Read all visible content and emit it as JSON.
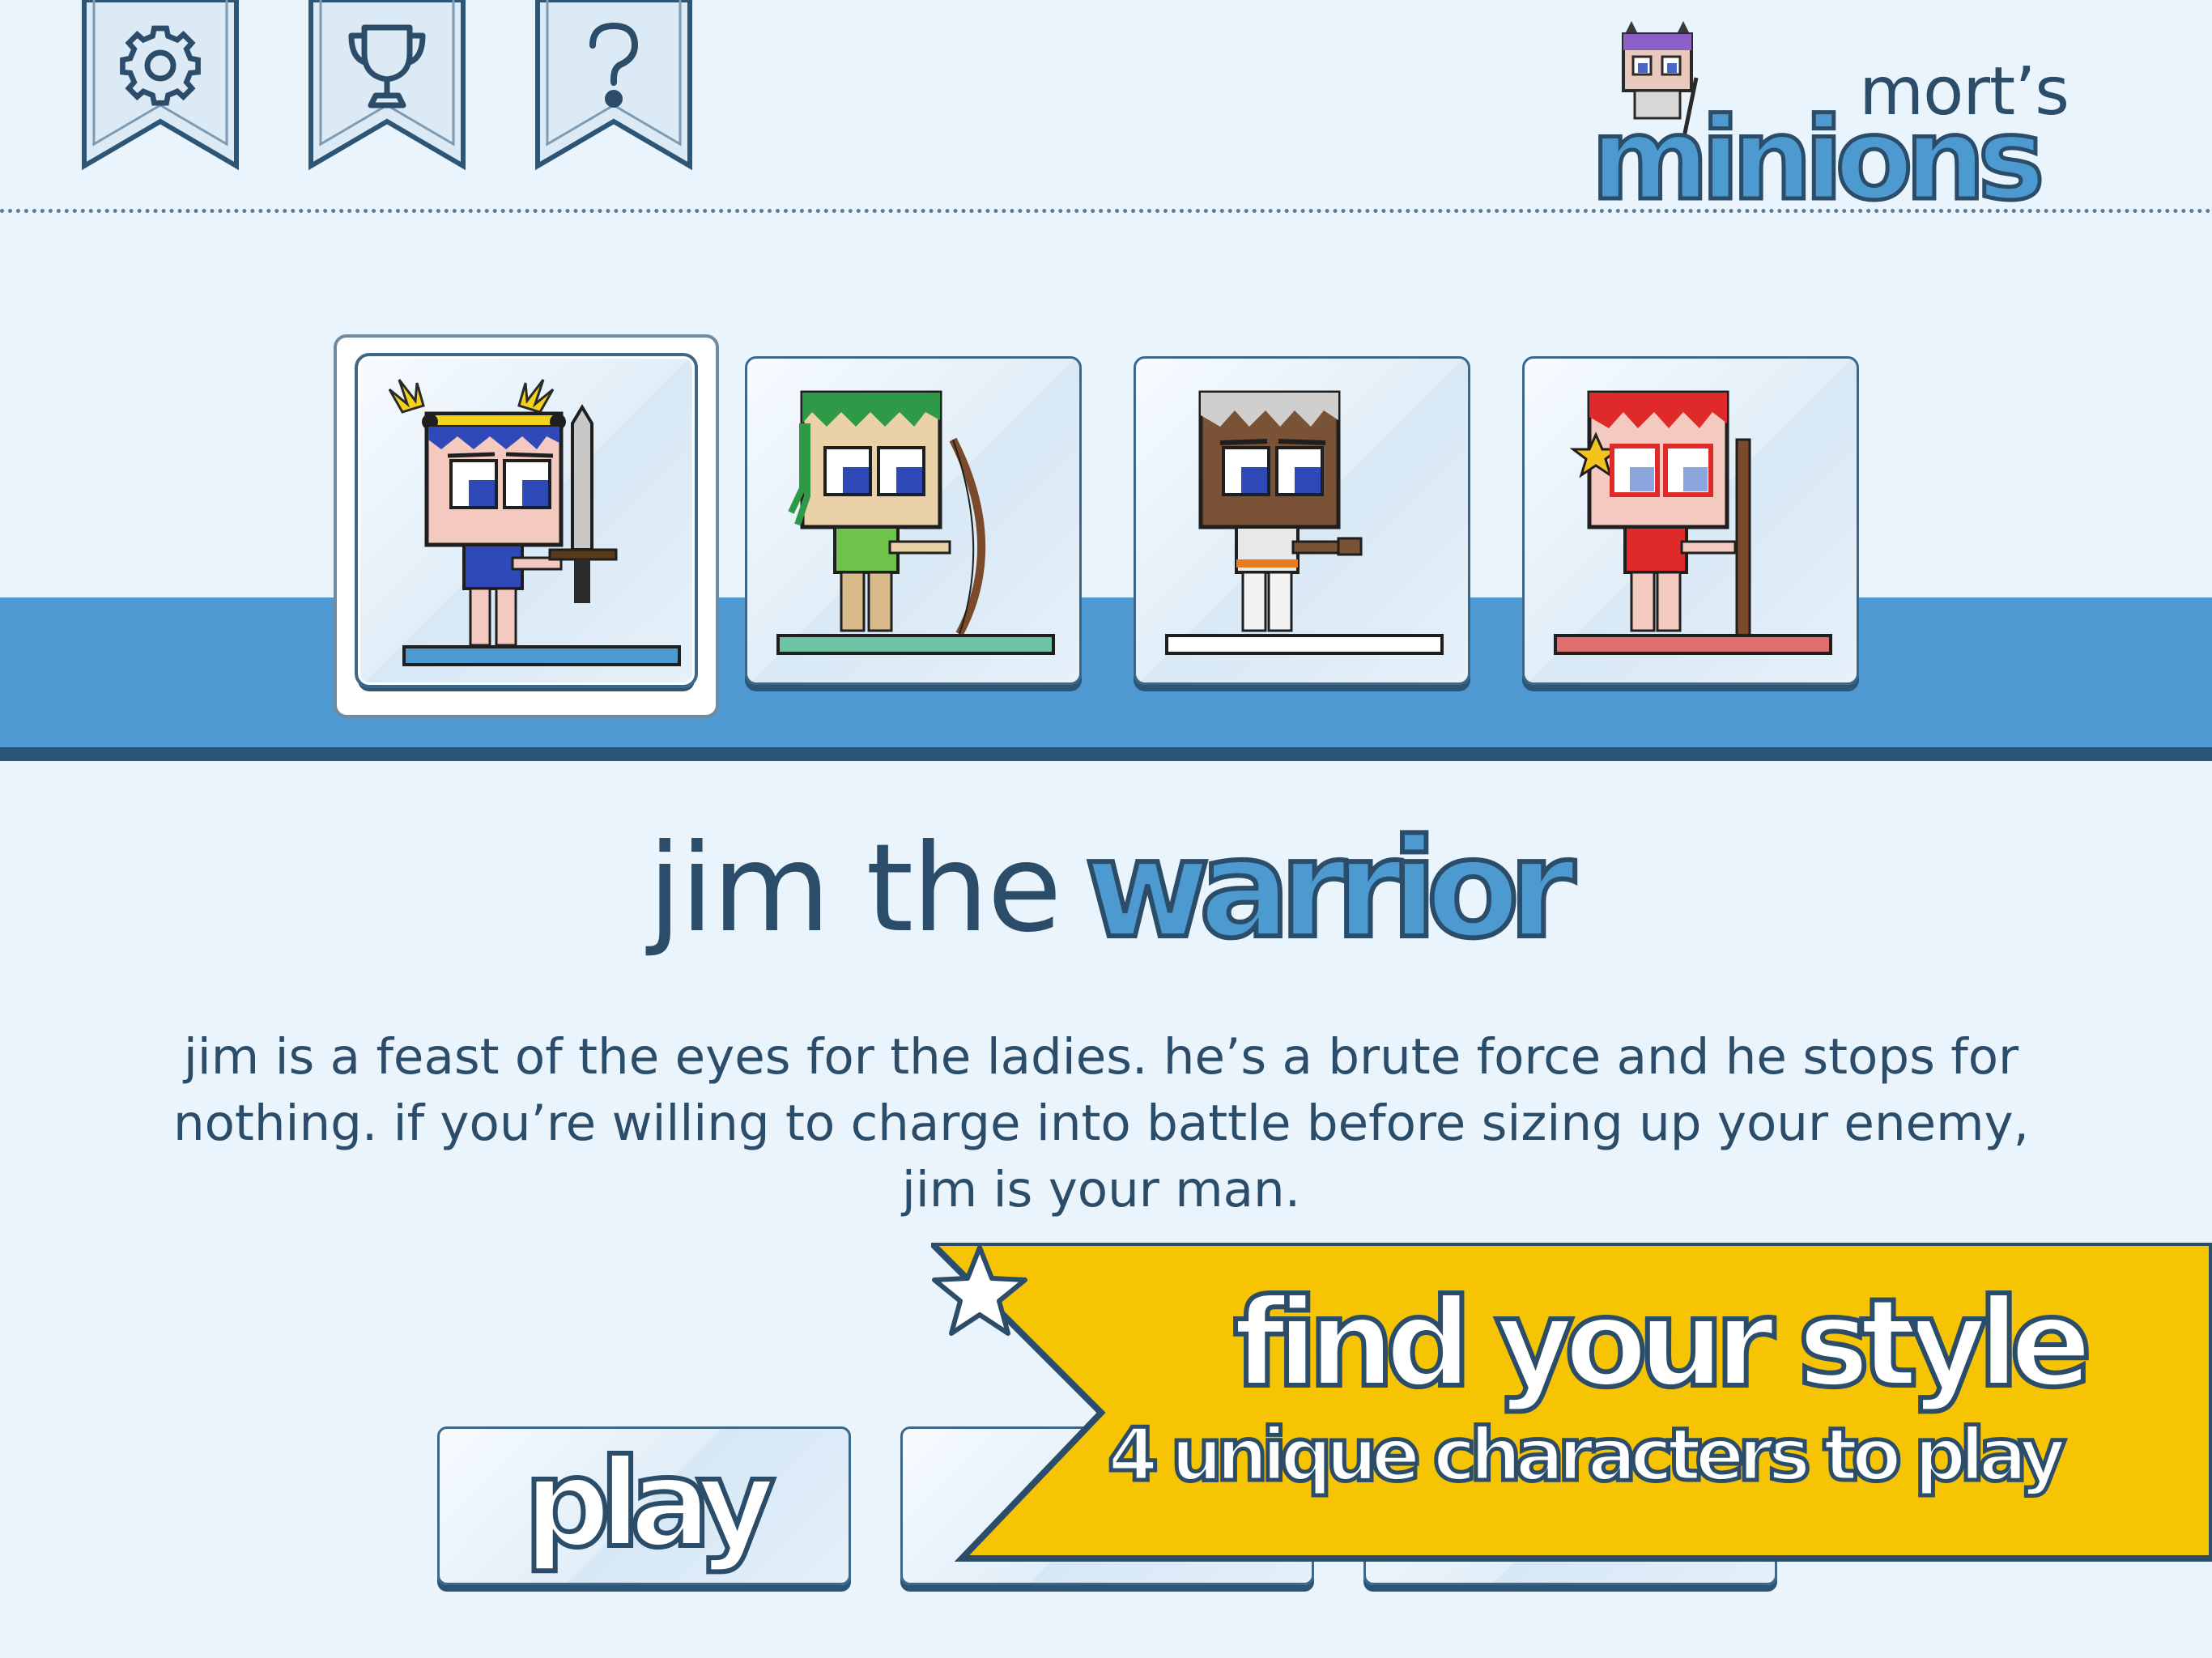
{
  "header": {
    "settings_icon": "gear-icon",
    "trophy_icon": "trophy-icon",
    "help_icon": "question-mark-icon"
  },
  "logo": {
    "top_text": "mort’s",
    "main_text": "minions"
  },
  "characters": [
    {
      "name": "jim",
      "class": "warrior",
      "weapon": "sword",
      "accent": "#4d9ad1",
      "hair": "#2f49b8",
      "selected": true
    },
    {
      "name": "",
      "class": "",
      "weapon": "bow",
      "accent": "#6cc4a4",
      "hair": "#2e9a48",
      "selected": false
    },
    {
      "name": "",
      "class": "",
      "weapon": "crossbow",
      "accent": "#ffffff",
      "hair": "#cfcfcf",
      "selected": false
    },
    {
      "name": "",
      "class": "",
      "weapon": "staff",
      "accent": "#e07070",
      "hair": "#e02a2a",
      "selected": false
    }
  ],
  "selected_character": {
    "name_text": "jim the",
    "class_text": "warrior",
    "description": "jim is a feast of the eyes for the ladies. he’s a brute force and he stops for nothing. if you’re willing to charge into battle before sizing up your enemy, jim is your man."
  },
  "buttons": {
    "play_label": "play"
  },
  "promo": {
    "title": "find your style",
    "subtitle": "4 unique characters to play",
    "star_icon": "star-icon"
  },
  "colors": {
    "background": "#eaf4fc",
    "band": "#4f9ad2",
    "navy": "#2b4d69",
    "promo_yellow": "#f7c404"
  }
}
